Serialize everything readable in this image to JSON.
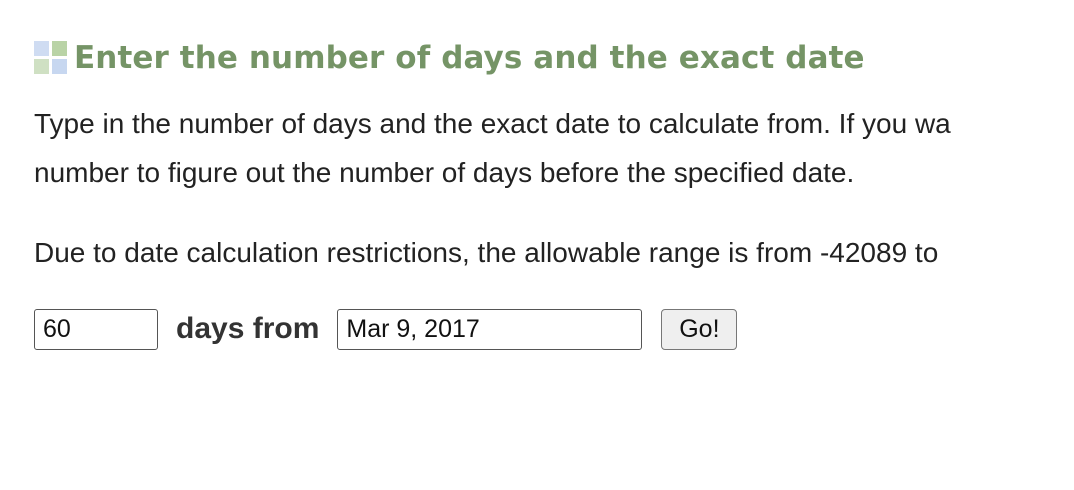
{
  "heading": {
    "icon": "grid-squares-icon",
    "title": "Enter the number of days and the exact date"
  },
  "instructions": {
    "line1": "Type in the number of days and the exact date to calculate from. If you wa",
    "line2": "number to figure out the number of days before the specified date.",
    "range_note": "Due to date calculation restrictions, the allowable range is from -42089 to"
  },
  "form": {
    "days_value": "60",
    "days_from_label": "days from",
    "date_value": "Mar 9, 2017",
    "go_label": "Go!"
  },
  "colors": {
    "heading": "#759466",
    "text": "#222222"
  }
}
